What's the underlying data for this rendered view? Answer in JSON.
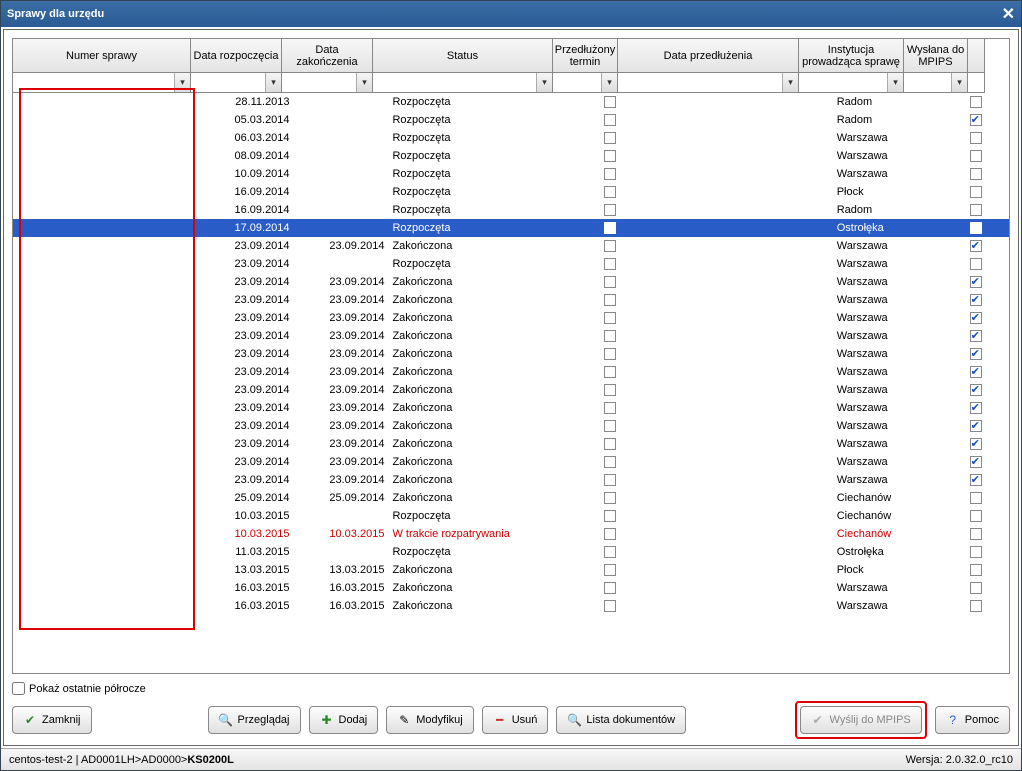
{
  "title": "Sprawy dla urzędu",
  "columns": {
    "num": "Numer sprawy",
    "start": "Data rozpoczęcia",
    "end": "Data zakończenia",
    "status": "Status",
    "ext": "Przedłużony termin",
    "extdate": "Data przedłużenia",
    "inst": "Instytucja prowadząca sprawę",
    "sent": "Wysłana do MPIPS"
  },
  "rows": [
    {
      "start": "28.11.2013",
      "end": "",
      "status": "Rozpoczęta",
      "ext": false,
      "extdate": "",
      "inst": "Radom",
      "sent": false,
      "sel": false,
      "red": false
    },
    {
      "start": "05.03.2014",
      "end": "",
      "status": "Rozpoczęta",
      "ext": false,
      "extdate": "",
      "inst": "Radom",
      "sent": true,
      "sel": false,
      "red": false
    },
    {
      "start": "06.03.2014",
      "end": "",
      "status": "Rozpoczęta",
      "ext": false,
      "extdate": "",
      "inst": "Warszawa",
      "sent": false,
      "sel": false,
      "red": false
    },
    {
      "start": "08.09.2014",
      "end": "",
      "status": "Rozpoczęta",
      "ext": false,
      "extdate": "",
      "inst": "Warszawa",
      "sent": false,
      "sel": false,
      "red": false
    },
    {
      "start": "10.09.2014",
      "end": "",
      "status": "Rozpoczęta",
      "ext": false,
      "extdate": "",
      "inst": "Warszawa",
      "sent": false,
      "sel": false,
      "red": false
    },
    {
      "start": "16.09.2014",
      "end": "",
      "status": "Rozpoczęta",
      "ext": false,
      "extdate": "",
      "inst": "Płock",
      "sent": false,
      "sel": false,
      "red": false
    },
    {
      "start": "16.09.2014",
      "end": "",
      "status": "Rozpoczęta",
      "ext": false,
      "extdate": "",
      "inst": "Radom",
      "sent": false,
      "sel": false,
      "red": false
    },
    {
      "start": "17.09.2014",
      "end": "",
      "status": "Rozpoczęta",
      "ext": false,
      "extdate": "",
      "inst": "Ostrołęka",
      "sent": false,
      "sel": true,
      "red": false
    },
    {
      "start": "23.09.2014",
      "end": "23.09.2014",
      "status": "Zakończona",
      "ext": false,
      "extdate": "",
      "inst": "Warszawa",
      "sent": true,
      "sel": false,
      "red": false
    },
    {
      "start": "23.09.2014",
      "end": "",
      "status": "Rozpoczęta",
      "ext": false,
      "extdate": "",
      "inst": "Warszawa",
      "sent": false,
      "sel": false,
      "red": false
    },
    {
      "start": "23.09.2014",
      "end": "23.09.2014",
      "status": "Zakończona",
      "ext": false,
      "extdate": "",
      "inst": "Warszawa",
      "sent": true,
      "sel": false,
      "red": false
    },
    {
      "start": "23.09.2014",
      "end": "23.09.2014",
      "status": "Zakończona",
      "ext": false,
      "extdate": "",
      "inst": "Warszawa",
      "sent": true,
      "sel": false,
      "red": false
    },
    {
      "start": "23.09.2014",
      "end": "23.09.2014",
      "status": "Zakończona",
      "ext": false,
      "extdate": "",
      "inst": "Warszawa",
      "sent": true,
      "sel": false,
      "red": false
    },
    {
      "start": "23.09.2014",
      "end": "23.09.2014",
      "status": "Zakończona",
      "ext": false,
      "extdate": "",
      "inst": "Warszawa",
      "sent": true,
      "sel": false,
      "red": false
    },
    {
      "start": "23.09.2014",
      "end": "23.09.2014",
      "status": "Zakończona",
      "ext": false,
      "extdate": "",
      "inst": "Warszawa",
      "sent": true,
      "sel": false,
      "red": false
    },
    {
      "start": "23.09.2014",
      "end": "23.09.2014",
      "status": "Zakończona",
      "ext": false,
      "extdate": "",
      "inst": "Warszawa",
      "sent": true,
      "sel": false,
      "red": false
    },
    {
      "start": "23.09.2014",
      "end": "23.09.2014",
      "status": "Zakończona",
      "ext": false,
      "extdate": "",
      "inst": "Warszawa",
      "sent": true,
      "sel": false,
      "red": false
    },
    {
      "start": "23.09.2014",
      "end": "23.09.2014",
      "status": "Zakończona",
      "ext": false,
      "extdate": "",
      "inst": "Warszawa",
      "sent": true,
      "sel": false,
      "red": false
    },
    {
      "start": "23.09.2014",
      "end": "23.09.2014",
      "status": "Zakończona",
      "ext": false,
      "extdate": "",
      "inst": "Warszawa",
      "sent": true,
      "sel": false,
      "red": false
    },
    {
      "start": "23.09.2014",
      "end": "23.09.2014",
      "status": "Zakończona",
      "ext": false,
      "extdate": "",
      "inst": "Warszawa",
      "sent": true,
      "sel": false,
      "red": false
    },
    {
      "start": "23.09.2014",
      "end": "23.09.2014",
      "status": "Zakończona",
      "ext": false,
      "extdate": "",
      "inst": "Warszawa",
      "sent": true,
      "sel": false,
      "red": false
    },
    {
      "start": "23.09.2014",
      "end": "23.09.2014",
      "status": "Zakończona",
      "ext": false,
      "extdate": "",
      "inst": "Warszawa",
      "sent": true,
      "sel": false,
      "red": false
    },
    {
      "start": "25.09.2014",
      "end": "25.09.2014",
      "status": "Zakończona",
      "ext": false,
      "extdate": "",
      "inst": "Ciechanów",
      "sent": false,
      "sel": false,
      "red": false
    },
    {
      "start": "10.03.2015",
      "end": "",
      "status": "Rozpoczęta",
      "ext": false,
      "extdate": "",
      "inst": "Ciechanów",
      "sent": false,
      "sel": false,
      "red": false
    },
    {
      "start": "10.03.2015",
      "end": "10.03.2015",
      "status": "W trakcie rozpatrywania",
      "ext": false,
      "extdate": "",
      "inst": "Ciechanów",
      "sent": false,
      "sel": false,
      "red": true
    },
    {
      "start": "11.03.2015",
      "end": "",
      "status": "Rozpoczęta",
      "ext": false,
      "extdate": "",
      "inst": "Ostrołęka",
      "sent": false,
      "sel": false,
      "red": false
    },
    {
      "start": "13.03.2015",
      "end": "13.03.2015",
      "status": "Zakończona",
      "ext": false,
      "extdate": "",
      "inst": "Płock",
      "sent": false,
      "sel": false,
      "red": false
    },
    {
      "start": "16.03.2015",
      "end": "16.03.2015",
      "status": "Zakończona",
      "ext": false,
      "extdate": "",
      "inst": "Warszawa",
      "sent": false,
      "sel": false,
      "red": false
    },
    {
      "start": "16.03.2015",
      "end": "16.03.2015",
      "status": "Zakończona",
      "ext": false,
      "extdate": "",
      "inst": "Warszawa",
      "sent": false,
      "sel": false,
      "red": false
    }
  ],
  "showLastHalfYear": "Pokaż ostatnie półrocze",
  "buttons": {
    "close": "Zamknij",
    "browse": "Przeglądaj",
    "add": "Dodaj",
    "modify": "Modyfikuj",
    "delete": "Usuń",
    "docs": "Lista dokumentów",
    "send": "Wyślij do MPIPS",
    "help": "Pomoc"
  },
  "status": {
    "left_prefix": "centos-test-2 | AD0001LH>AD0000>",
    "left_bold": "KS0200L",
    "right": "Wersja: 2.0.32.0_rc10"
  }
}
